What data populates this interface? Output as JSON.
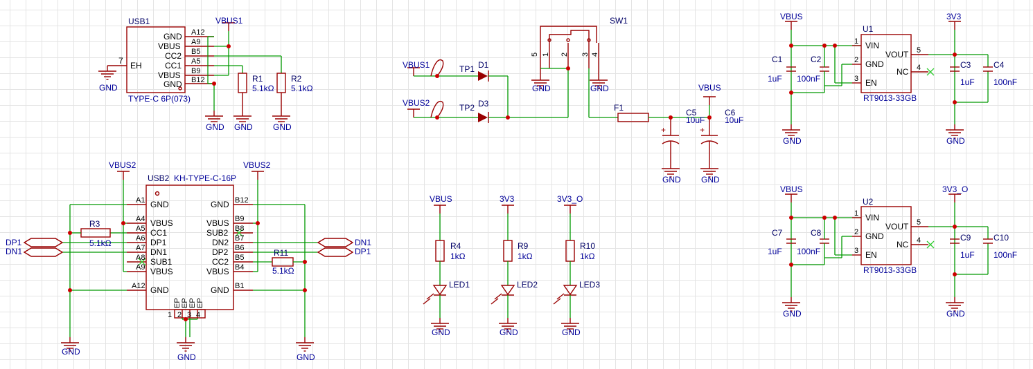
{
  "nets": {
    "vbus": "VBUS",
    "vbus1": "VBUS1",
    "vbus2": "VBUS2",
    "gnd": "GND",
    "v3": "3V3",
    "v3o": "3V3_O",
    "dp1": "DP1",
    "dn1": "DN1"
  },
  "usb1": {
    "ref": "USB1",
    "val": "TYPE-C 6P(073)",
    "pin7": "7",
    "eh": "EH",
    "pins": [
      {
        "name": "GND",
        "num": "A12"
      },
      {
        "name": "VBUS",
        "num": "A9"
      },
      {
        "name": "CC2",
        "num": "B5"
      },
      {
        "name": "CC1",
        "num": "A5"
      },
      {
        "name": "VBUS",
        "num": "B9"
      },
      {
        "name": "GND",
        "num": "B12"
      }
    ]
  },
  "r1": {
    "ref": "R1",
    "val": "5.1kΩ"
  },
  "r2": {
    "ref": "R2",
    "val": "5.1kΩ"
  },
  "usb2": {
    "ref": "USB2",
    "val": "KH-TYPE-C-16P",
    "left": [
      {
        "name": "GND",
        "num": "A1"
      },
      {
        "name": "VBUS",
        "num": "A4"
      },
      {
        "name": "CC1",
        "num": "A5"
      },
      {
        "name": "DP1",
        "num": "A6"
      },
      {
        "name": "DN1",
        "num": "A7"
      },
      {
        "name": "SUB1",
        "num": "A8"
      },
      {
        "name": "VBUS",
        "num": "A9"
      },
      {
        "name": "GND",
        "num": "A12"
      }
    ],
    "right": [
      {
        "name": "GND",
        "num": "B12"
      },
      {
        "name": "VBUS",
        "num": "B9"
      },
      {
        "name": "SUB2",
        "num": "B8"
      },
      {
        "name": "DN2",
        "num": "B7"
      },
      {
        "name": "DP2",
        "num": "B6"
      },
      {
        "name": "CC2",
        "num": "B5"
      },
      {
        "name": "VBUS",
        "num": "B4"
      },
      {
        "name": "GND",
        "num": "B1"
      }
    ],
    "ep": [
      "EP",
      "EP",
      "EP",
      "EP"
    ],
    "epnums": [
      "1",
      "2",
      "3",
      "4"
    ]
  },
  "r3": {
    "ref": "R3",
    "val": "5.1kΩ"
  },
  "r11": {
    "ref": "R11",
    "val": "5.1kΩ"
  },
  "tp1": "TP1",
  "tp2": "TP2",
  "d1": "D1",
  "d3": "D3",
  "sw1": {
    "ref": "SW1",
    "pins": [
      "5",
      "1",
      "2",
      "3",
      "4"
    ]
  },
  "f1": "F1",
  "c5": {
    "ref": "C5",
    "val": "10uF"
  },
  "c6": {
    "ref": "C6",
    "val": "10uF"
  },
  "leds": [
    {
      "rref": "R4",
      "rval": "1kΩ",
      "led": "LED1"
    },
    {
      "rref": "R9",
      "rval": "1kΩ",
      "led": "LED2"
    },
    {
      "rref": "R10",
      "rval": "1kΩ",
      "led": "LED3"
    }
  ],
  "u1": {
    "ref": "U1",
    "val": "RT9013-33GB",
    "c1": "C1",
    "c1v": "1uF",
    "c2": "C2",
    "c2v": "100nF",
    "c3": "C3",
    "c3v": "1uF",
    "c4": "C4",
    "c4v": "100nF"
  },
  "u2": {
    "ref": "U2",
    "val": "RT9013-33GB",
    "c1": "C7",
    "c1v": "1uF",
    "c2": "C8",
    "c2v": "100nF",
    "c3": "C9",
    "c3v": "1uF",
    "c4": "C10",
    "c4v": "100nF"
  },
  "reg": {
    "pins": [
      {
        "name": "VIN",
        "num": "1"
      },
      {
        "name": "GND",
        "num": "2"
      },
      {
        "name": "EN",
        "num": "3"
      },
      {
        "name": "VOUT",
        "num": "5"
      },
      {
        "name": "NC",
        "num": "4"
      }
    ]
  }
}
